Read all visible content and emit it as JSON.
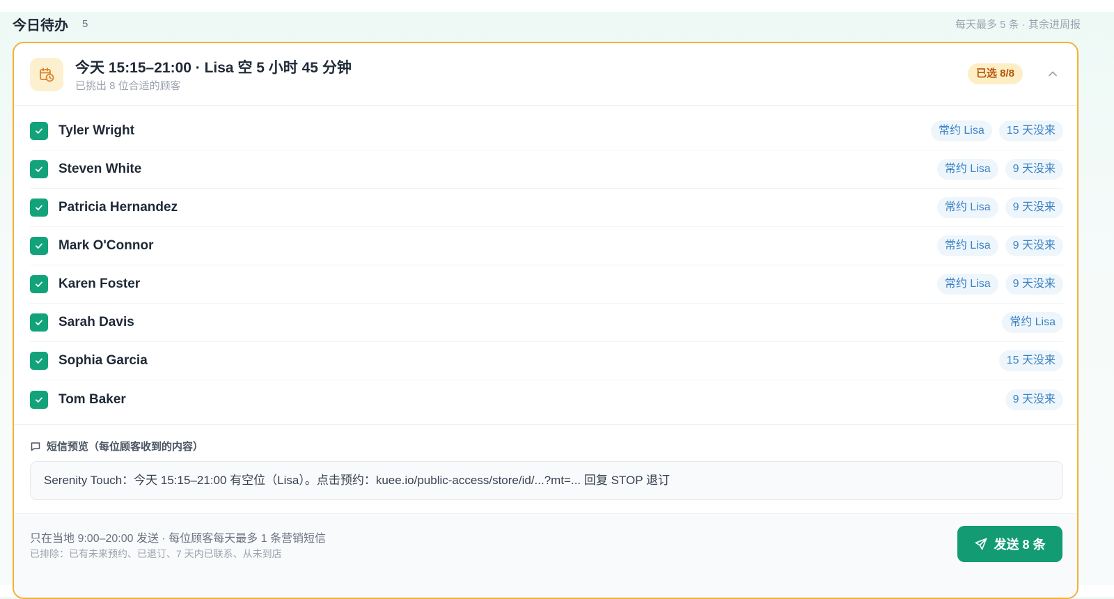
{
  "section": {
    "title": "今日待办",
    "count": "5",
    "note": "每天最多 5 条 · 其余进周报"
  },
  "slot": {
    "icon": "calendar-clock-icon",
    "title": "今天 15:15–21:00 · Lisa 空 5 小时 45 分钟",
    "subtitle": "已挑出 8 位合适的顾客",
    "selected_badge": "已选 8/8"
  },
  "customers": [
    {
      "name": "Tyler Wright",
      "checked": true,
      "tags": [
        "常约 Lisa",
        "15 天没来"
      ]
    },
    {
      "name": "Steven White",
      "checked": true,
      "tags": [
        "常约 Lisa",
        "9 天没来"
      ]
    },
    {
      "name": "Patricia Hernandez",
      "checked": true,
      "tags": [
        "常约 Lisa",
        "9 天没来"
      ]
    },
    {
      "name": "Mark O'Connor",
      "checked": true,
      "tags": [
        "常约 Lisa",
        "9 天没来"
      ]
    },
    {
      "name": "Karen Foster",
      "checked": true,
      "tags": [
        "常约 Lisa",
        "9 天没来"
      ]
    },
    {
      "name": "Sarah Davis",
      "checked": true,
      "tags": [
        "常约 Lisa"
      ]
    },
    {
      "name": "Sophia Garcia",
      "checked": true,
      "tags": [
        "15 天没来"
      ]
    },
    {
      "name": "Tom Baker",
      "checked": true,
      "tags": [
        "9 天没来"
      ]
    }
  ],
  "sms": {
    "label": "短信预览（每位顾客收到的内容）",
    "text": "Serenity Touch：今天 15:15–21:00 有空位（Lisa）。点击预约：kuee.io/public-access/store/id/...?mt=... 回复 STOP 退订"
  },
  "footer": {
    "rule": "只在当地 9:00–20:00 发送 · 每位顾客每天最多 1 条营销短信",
    "excluded": "已排除：已有未来预约、已退订、7 天内已联系、从未到店",
    "send_label": "发送 8 条"
  },
  "colors": {
    "accent": "#139c74",
    "card_border": "#f2b233",
    "badge_bg": "#fdeec6",
    "badge_text": "#b45309",
    "tag_bg": "#eef6fc",
    "tag_text": "#3b82c4"
  }
}
